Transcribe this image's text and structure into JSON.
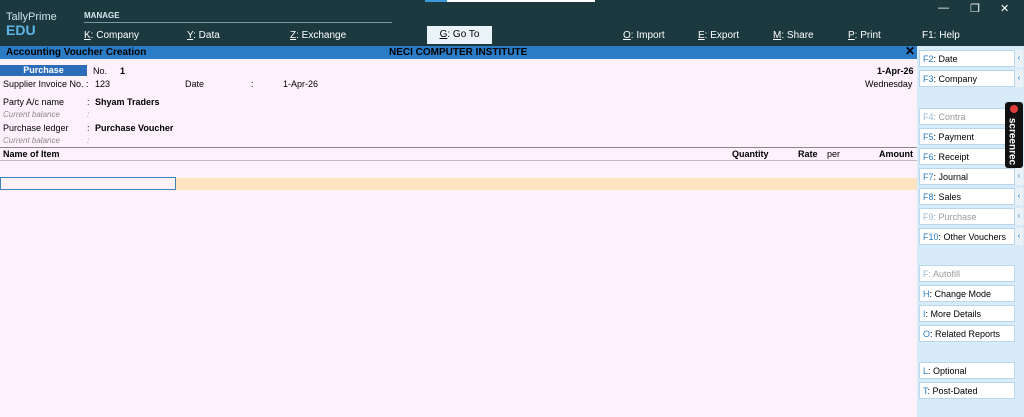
{
  "app": {
    "name": "TallyPrime",
    "edition": "EDU"
  },
  "topbar": {
    "manage_label": "MANAGE",
    "menus": [
      {
        "key": "K",
        "label": ": Company"
      },
      {
        "key": "Y",
        "label": ": Data"
      },
      {
        "key": "Z",
        "label": ": Exchange"
      },
      {
        "key": "G",
        "label": ": Go To"
      },
      {
        "key": "O",
        "label": ": Import"
      },
      {
        "key": "E",
        "label": ": Export"
      },
      {
        "key": "M",
        "label": ": Share"
      },
      {
        "key": "P",
        "label": ": Print"
      },
      {
        "key": "F1",
        "label": ": Help"
      }
    ],
    "window_controls": {
      "minimize": "—",
      "restore": "❐",
      "close": "✕"
    }
  },
  "titlebar": {
    "title": "Accounting Voucher Creation",
    "company": "NECI COMPUTER INSTITUTE",
    "close": "✕"
  },
  "voucher": {
    "type": "Purchase",
    "no_label": "No.",
    "no_value": "1",
    "date_top": "1-Apr-26",
    "weekday": "Wednesday",
    "supplier_invoice_label": "Supplier Invoice No. :",
    "supplier_invoice_value": "123",
    "date_label": "Date",
    "date_colon": ":",
    "date_value": "1-Apr-26",
    "party_label": "Party A/c name",
    "party_value": "Shyam Traders",
    "current_balance_label": "Current balance",
    "purchase_ledger_label": "Purchase ledger",
    "purchase_ledger_value": "Purchase Voucher",
    "colon": ":"
  },
  "table": {
    "headers": {
      "name": "Name of Item",
      "quantity": "Quantity",
      "rate": "Rate",
      "per": "per",
      "amount": "Amount"
    }
  },
  "sidebar": {
    "group1": [
      {
        "key": "F2",
        "label": ": Date",
        "enabled": true
      },
      {
        "key": "F3",
        "label": ": Company",
        "enabled": true
      }
    ],
    "group2": [
      {
        "key": "F4",
        "label": ": Contra",
        "enabled": false
      },
      {
        "key": "F5",
        "label": ": Payment",
        "enabled": true
      },
      {
        "key": "F6",
        "label": ": Receipt",
        "enabled": true
      },
      {
        "key": "F7",
        "label": ": Journal",
        "enabled": true
      },
      {
        "key": "F8",
        "label": ": Sales",
        "enabled": true
      },
      {
        "key": "F9",
        "label": ": Purchase",
        "enabled": false
      },
      {
        "key": "F10",
        "label": ": Other Vouchers",
        "enabled": true
      }
    ],
    "group3": [
      {
        "key": "F",
        "label": ": Autofill",
        "enabled": false
      },
      {
        "key": "H",
        "label": ": Change Mode",
        "enabled": true
      },
      {
        "key": "I",
        "label": ": More Details",
        "enabled": true
      },
      {
        "key": "O",
        "label": ": Related Reports",
        "enabled": true
      }
    ],
    "group4": [
      {
        "key": "L",
        "label": ": Optional",
        "enabled": true
      },
      {
        "key": "T",
        "label": ": Post-Dated",
        "enabled": true
      }
    ],
    "arrow": "‹"
  },
  "overlay": {
    "label": "screenrec"
  },
  "colors": {
    "topbar": "#1c3940",
    "accent": "#2b7cc7",
    "highlight_row": "#fde4c0",
    "background": "#fdf2fb"
  }
}
